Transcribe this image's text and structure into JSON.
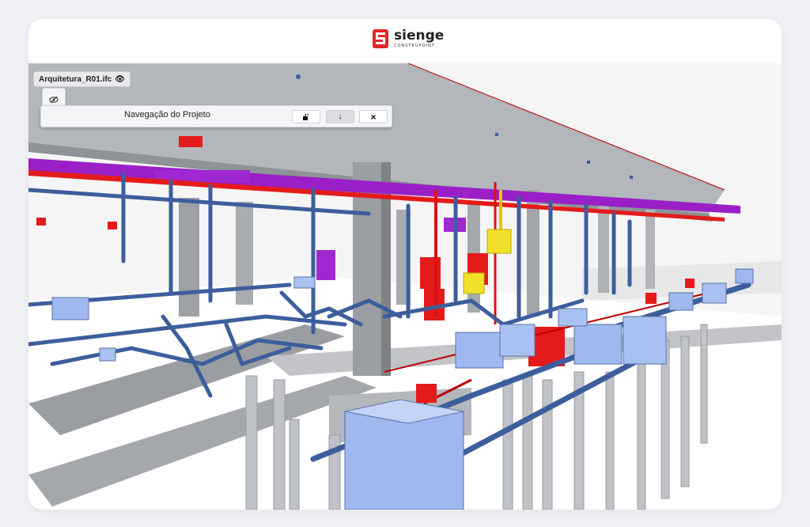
{
  "brand": {
    "name": "sienge",
    "sub": "CONSTRUPOINT",
    "color": "#e3262a"
  },
  "viewer": {
    "file_label": "Arquitetura_R01.ifc",
    "file_icon": "eye-icon",
    "toggle_icon": "eye-slash-icon"
  },
  "navigation": {
    "title": "Navegação do Projeto",
    "buttons": [
      {
        "icon": "unlock-icon",
        "glyph": "■"
      },
      {
        "icon": "arrow-down-icon",
        "glyph": "↓"
      },
      {
        "icon": "close-icon",
        "glyph": "×"
      }
    ]
  },
  "colors": {
    "concrete": "#b9bcc0",
    "pipe_blue": "#3d5e9c",
    "box_blue": "#a9c1f0",
    "fire_red": "#e51b1b",
    "duct_purple": "#a020c8",
    "yellow": "#f2e12a"
  }
}
